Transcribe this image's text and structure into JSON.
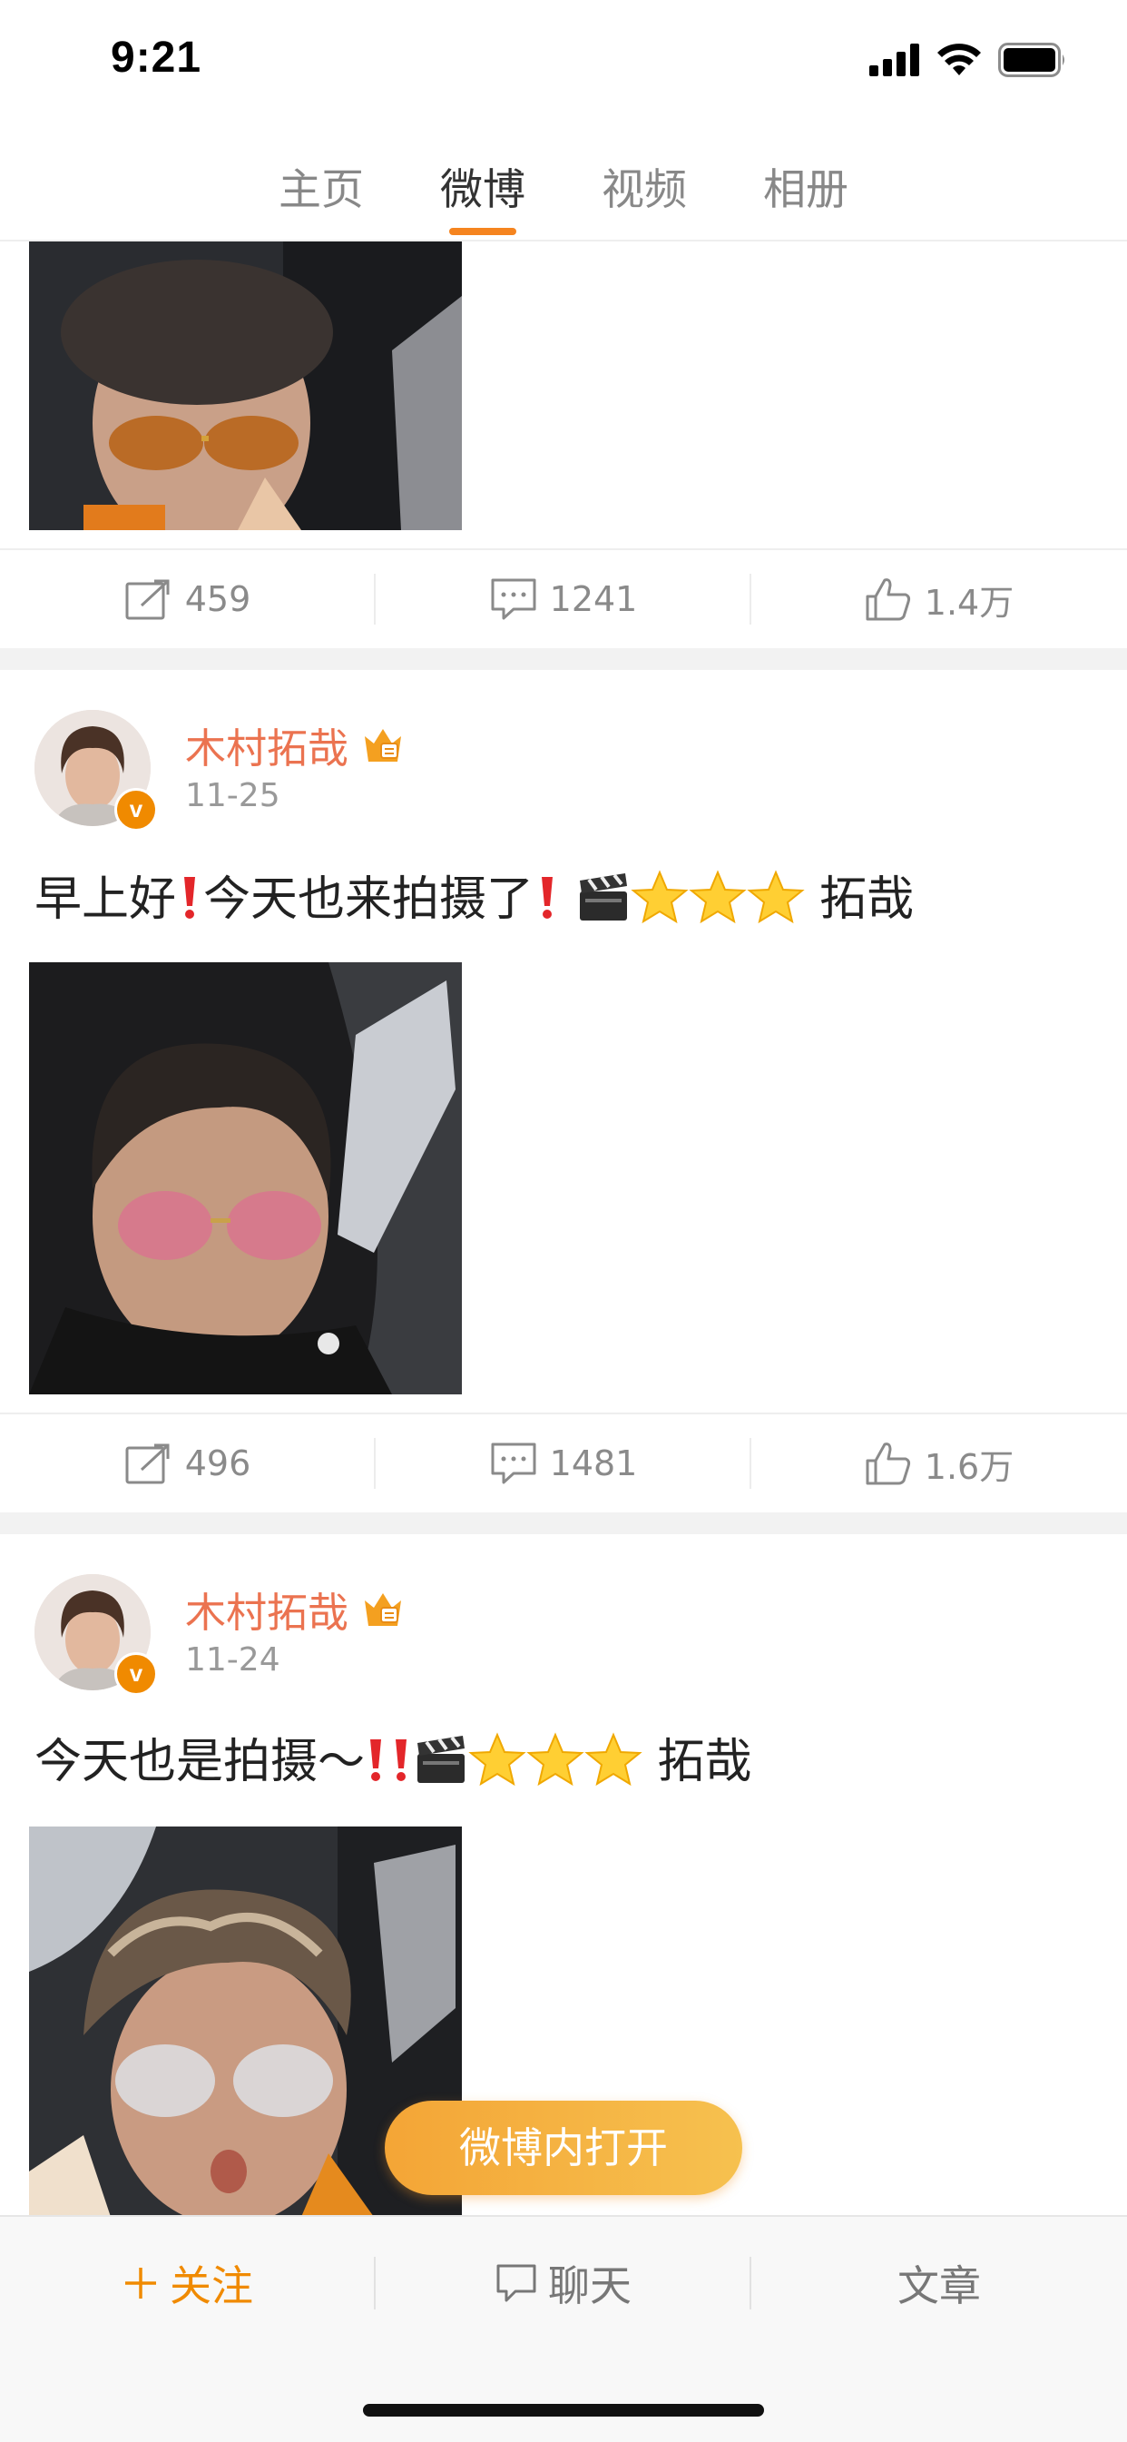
{
  "status_bar": {
    "time": "9:21"
  },
  "top_tabs": [
    {
      "label": "主页",
      "active": false
    },
    {
      "label": "微博",
      "active": true
    },
    {
      "label": "视频",
      "active": false
    },
    {
      "label": "相册",
      "active": false
    }
  ],
  "posts": [
    {
      "partial": true,
      "stats": {
        "reposts": "459",
        "comments": "1241",
        "likes": "1.4万"
      }
    },
    {
      "author": "木村拓哉",
      "date": "11-25",
      "text_a": "早上好",
      "text_b": "今天也来拍摄了",
      "signature": "拓哉",
      "stats": {
        "reposts": "496",
        "comments": "1481",
        "likes": "1.6万"
      }
    },
    {
      "author": "木村拓哉",
      "date": "11-24",
      "text_a": "今天也是拍摄～",
      "signature": "拓哉"
    }
  ],
  "open_in_app_label": "微博内打开",
  "bottom_bar": {
    "follow_label": "关注",
    "chat_label": "聊天",
    "article_label": "文章"
  },
  "colors": {
    "accent": "#f08a00",
    "username": "#eb7350"
  }
}
